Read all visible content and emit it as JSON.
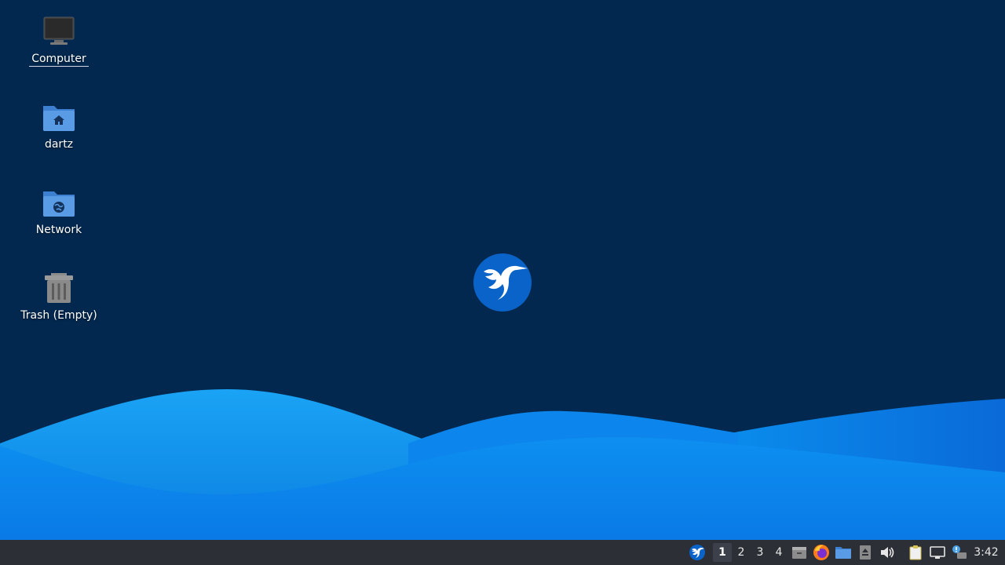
{
  "desktop": {
    "background_color": "#02284f",
    "icons": [
      {
        "label": "Computer",
        "icon": "computer-icon"
      },
      {
        "label": "dartz",
        "icon": "home-folder-icon"
      },
      {
        "label": "Network",
        "icon": "network-folder-icon"
      },
      {
        "label": "Trash (Empty)",
        "icon": "trash-icon"
      }
    ],
    "center_logo": "hummingbird-logo"
  },
  "taskbar": {
    "background_color": "#2c2f36",
    "menu_icon": "hummingbird-menu-icon",
    "workspaces": [
      "1",
      "2",
      "3",
      "4"
    ],
    "active_workspace": "1",
    "launchers": [
      "file-manager-icon",
      "firefox-icon",
      "folder-icon"
    ],
    "tray": [
      "eject-icon",
      "volume-icon",
      "clipboard-icon",
      "network-icon",
      "update-notifier-icon"
    ],
    "clock": "3:42"
  }
}
